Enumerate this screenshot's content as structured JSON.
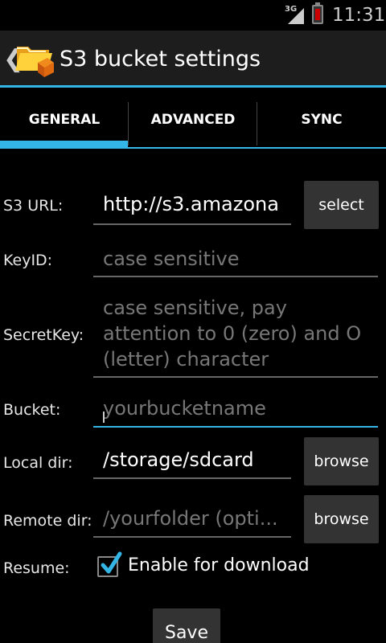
{
  "status_bar": {
    "network": "3G",
    "time": "11:31"
  },
  "action_bar": {
    "title": "S3 bucket settings",
    "back": "❮"
  },
  "tabs": [
    {
      "label": "GENERAL",
      "selected": true
    },
    {
      "label": "ADVANCED",
      "selected": false
    },
    {
      "label": "SYNC",
      "selected": false
    }
  ],
  "form": {
    "s3_url": {
      "label": "S3 URL:",
      "value": "http://s3.amazona",
      "button": "select"
    },
    "key_id": {
      "label": "KeyID:",
      "placeholder": "case sensitive"
    },
    "secret_key": {
      "label": "SecretKey:",
      "placeholder": "case sensitive, pay attention to 0 (zero) and O (letter) character"
    },
    "bucket": {
      "label": "Bucket:",
      "placeholder": "yourbucketname"
    },
    "local_dir": {
      "label": "Local dir:",
      "value": "/storage/sdcard",
      "button": "browse"
    },
    "remote_dir": {
      "label": "Remote dir:",
      "placeholder": "/yourfolder (opti...",
      "button": "browse"
    },
    "resume": {
      "label": "Resume:",
      "checkbox_label": "Enable for download",
      "checked": true
    }
  },
  "save_button": "Save",
  "colors": {
    "accent": "#33b5e5",
    "background": "#000000",
    "button": "#333333"
  }
}
